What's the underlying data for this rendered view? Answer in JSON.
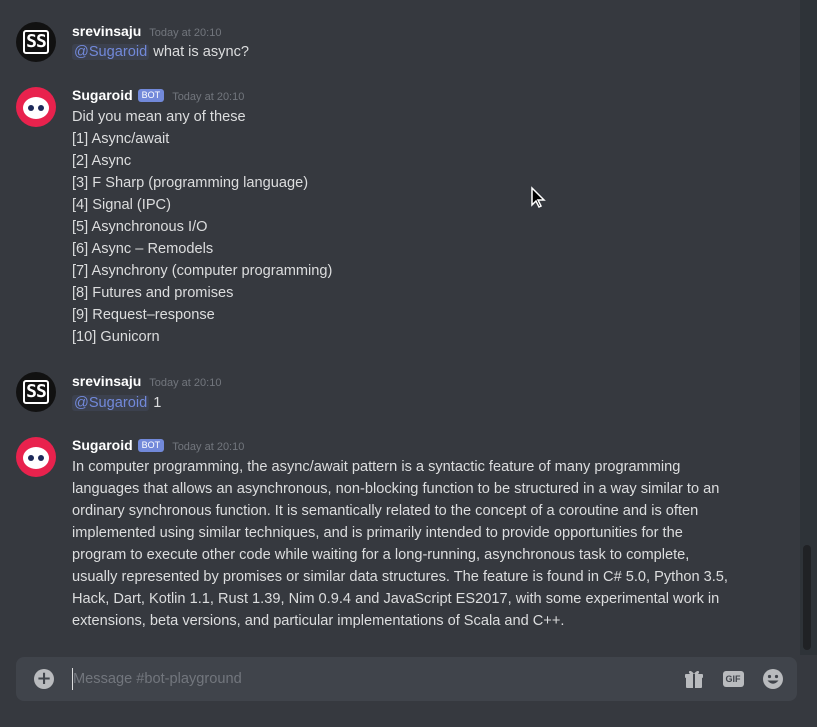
{
  "messages": [
    {
      "username": "srevinsaju",
      "timestamp": "Today at 20:10",
      "mention": "@Sugaroid",
      "text": "what is async?"
    },
    {
      "username": "Sugaroid",
      "badge": "BOT",
      "timestamp": "Today at 20:10",
      "lines": [
        "Did you mean any of these",
        "[1] Async/await",
        "[2] Async",
        "[3] F Sharp (programming language)",
        "[4] Signal (IPC)",
        "[5] Asynchronous I/O",
        "[6] Async – Remodels",
        "[7] Asynchrony (computer programming)",
        "[8] Futures and promises",
        "[9] Request–response",
        "[10] Gunicorn"
      ]
    },
    {
      "username": "srevinsaju",
      "timestamp": "Today at 20:10",
      "mention": "@Sugaroid",
      "text": "1"
    },
    {
      "username": "Sugaroid",
      "badge": "BOT",
      "timestamp": "Today at 20:10",
      "lines": [
        "In computer programming, the async/await pattern is a syntactic feature of many programming",
        "languages that allows an asynchronous, non-blocking function to be structured in a way similar to an",
        "ordinary synchronous function. It is semantically related to the concept of a coroutine and is often",
        "implemented using similar techniques, and is primarily intended to provide opportunities for the",
        "program to execute other code while waiting for a long-running, asynchronous task to complete,",
        "usually represented by promises or similar data structures. The feature is found in C# 5.0, Python 3.5,",
        "Hack, Dart, Kotlin 1.1, Rust 1.39, Nim 0.9.4 and JavaScript ES2017, with some experimental work in",
        "extensions, beta versions, and particular implementations of Scala and C++."
      ]
    }
  ],
  "avatars": {
    "user_initials": "SS"
  },
  "composer": {
    "placeholder": "Message #bot-playground",
    "gif_label": "GIF",
    "icons": [
      "plus-circle-icon",
      "gift-icon",
      "gif-icon",
      "emoji-icon"
    ]
  },
  "colors": {
    "background": "#36393f",
    "mention": "#7289da",
    "bot_avatar": "#e8224d",
    "composer": "#40444b"
  }
}
